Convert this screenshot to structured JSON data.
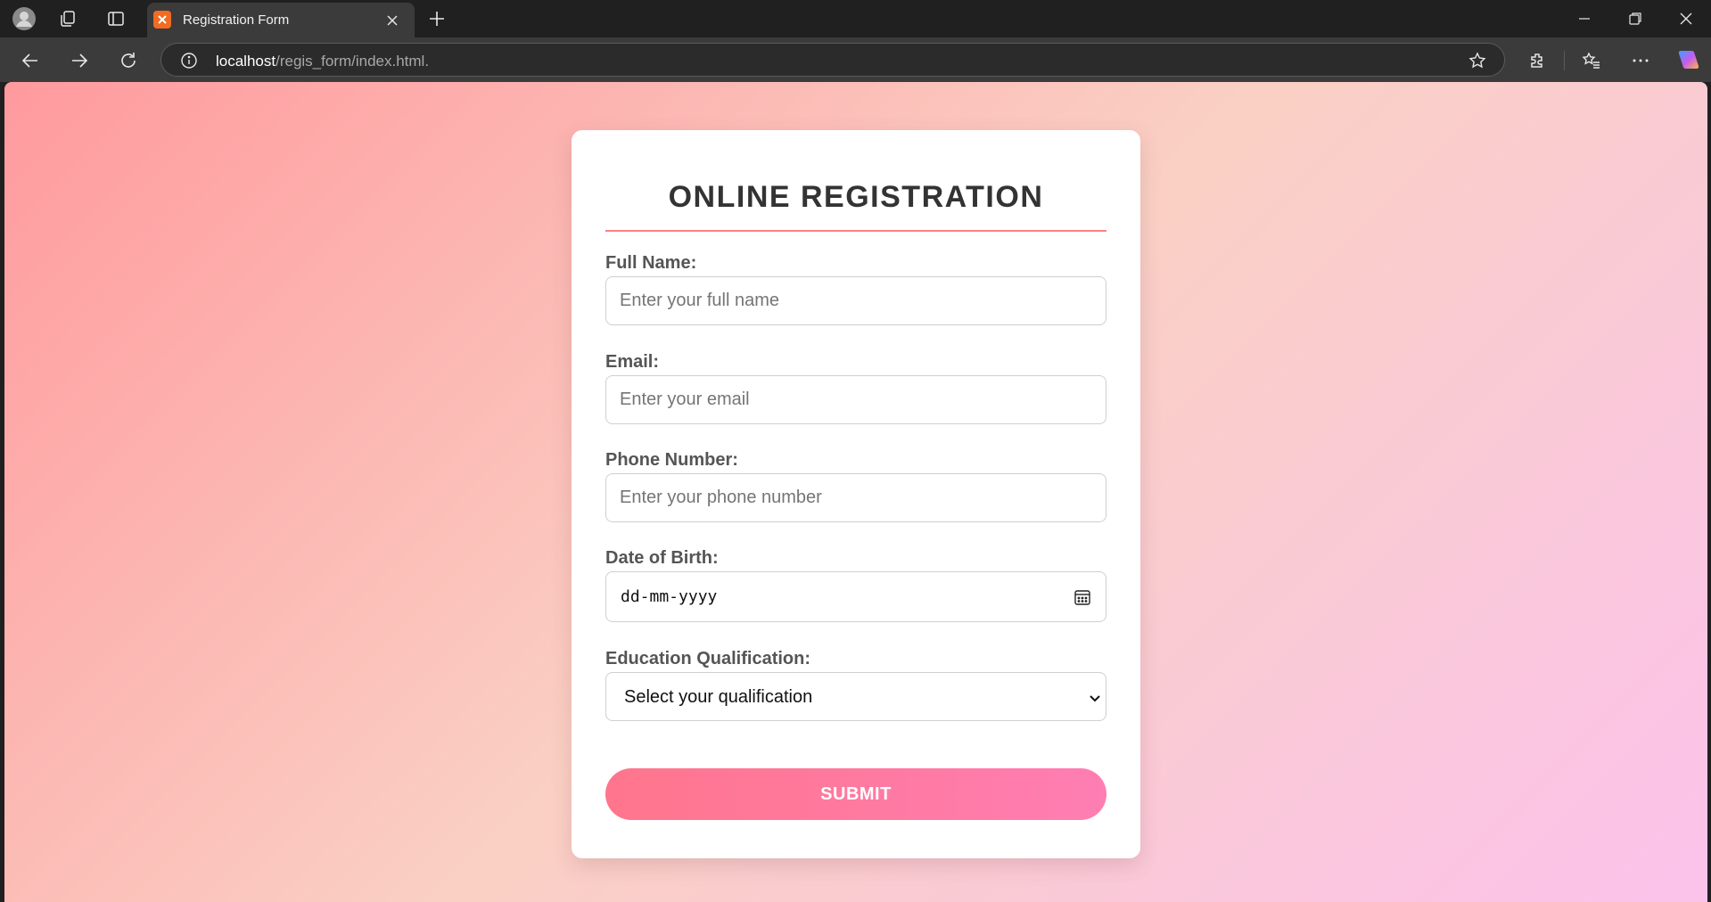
{
  "browser": {
    "tab_title": "Registration Form",
    "url_host": "localhost",
    "url_path": "/regis_form/index.html."
  },
  "form": {
    "title": "ONLINE REGISTRATION",
    "full_name": {
      "label": "Full Name:",
      "placeholder": "Enter your full name",
      "value": ""
    },
    "email": {
      "label": "Email:",
      "placeholder": "Enter your email",
      "value": ""
    },
    "phone": {
      "label": "Phone Number:",
      "placeholder": "Enter your phone number",
      "value": ""
    },
    "dob": {
      "label": "Date of Birth:",
      "display": "dd-mm-yyyy"
    },
    "education": {
      "label": "Education Qualification:",
      "selected": "Select your qualification"
    },
    "submit_label": "SUBMIT"
  },
  "colors": {
    "accent": "#ff758c",
    "accent_end": "#ff7eb3",
    "title_rule": "#ff7f88",
    "favicon": "#f26b22"
  }
}
